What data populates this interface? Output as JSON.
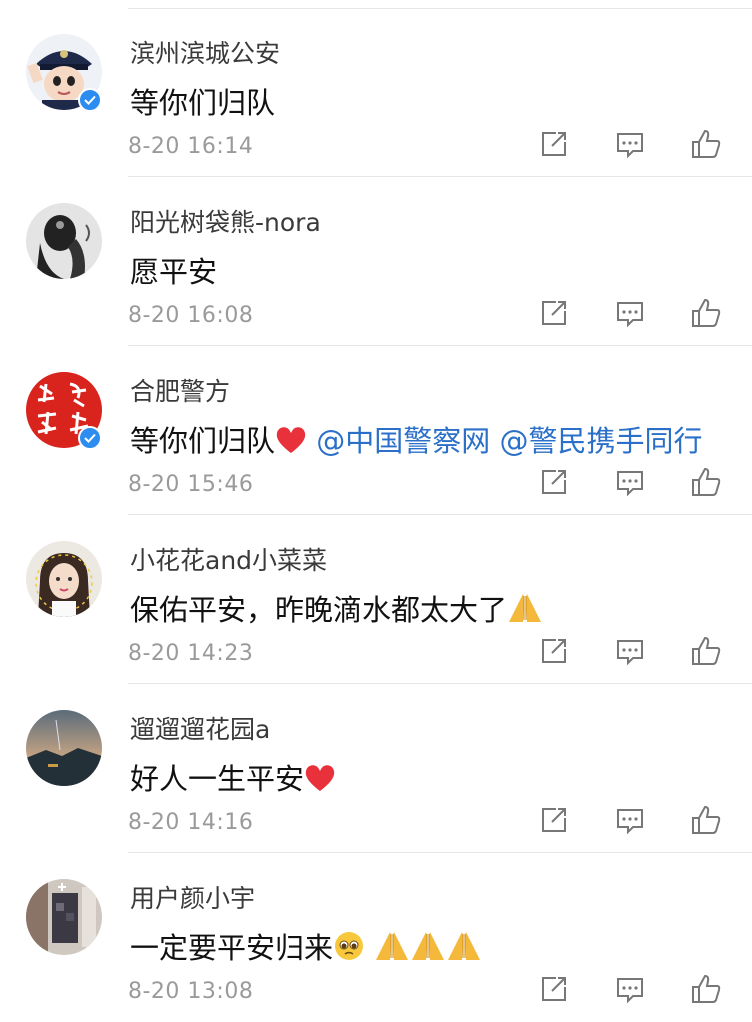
{
  "comments": [
    {
      "username": "滨州滨城公安",
      "text": "等你们归队",
      "time": "8-20 16:14",
      "verified": true,
      "avatar_icon": "police-cartoon-avatar"
    },
    {
      "username": "阳光树袋熊-nora",
      "text": "愿平安",
      "time": "8-20 16:08",
      "verified": false,
      "avatar_icon": "bw-portrait-avatar"
    },
    {
      "username": "合肥警方",
      "text": "等你们归队",
      "mentions": [
        "@中国警察网",
        "@警民携手同行"
      ],
      "time": "8-20 15:46",
      "verified": true,
      "avatar_icon": "calligraphy-avatar"
    },
    {
      "username": "小花花and小菜菜",
      "text": "保佑平安，昨晚滴水都太大了",
      "time": "8-20 14:23",
      "verified": false,
      "avatar_icon": "girl-selfie-avatar"
    },
    {
      "username": "遛遛遛花园a",
      "text": "好人一生平安",
      "time": "8-20 14:16",
      "verified": false,
      "avatar_icon": "landscape-avatar"
    },
    {
      "username": "用户颜小宇",
      "text": "一定要平安归来",
      "time": "8-20 13:08",
      "verified": false,
      "avatar_icon": "blurred-photo-avatar"
    }
  ],
  "colors": {
    "mention": "#2b70c8",
    "verified": "#2d8cf0",
    "heart": "#e8313a"
  },
  "action_icons": [
    "repost-icon",
    "comment-icon",
    "like-icon"
  ]
}
